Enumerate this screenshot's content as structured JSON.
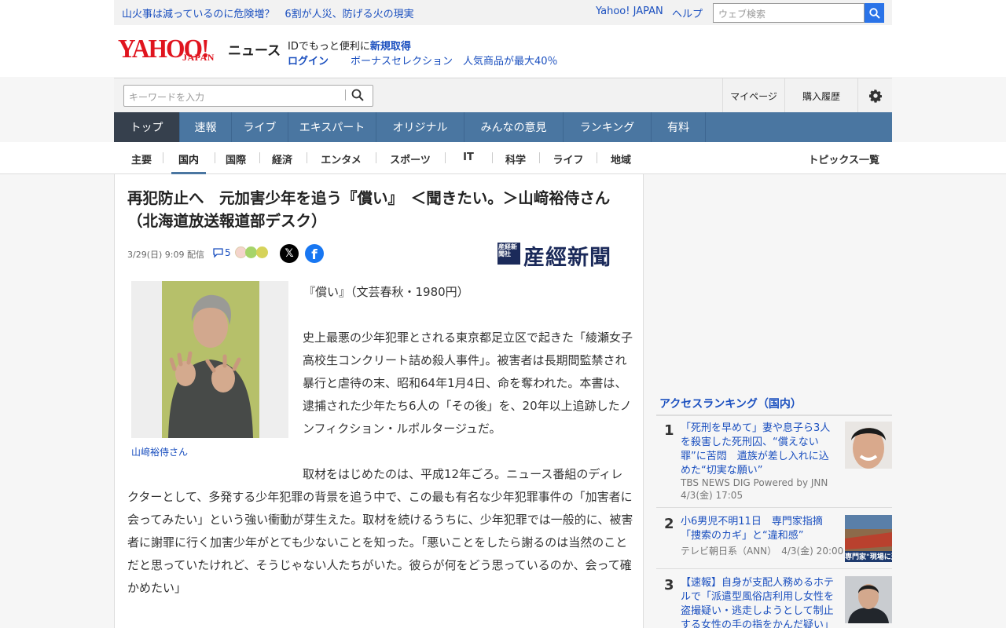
{
  "topbar": {
    "headline": "山火事は減っているのに危険増？　6割が人災、防げる火の現実",
    "yahoo_japan": "Yahoo! JAPAN",
    "help": "ヘルプ",
    "web_search_placeholder": "ウェブ検索"
  },
  "header": {
    "logo_text": "YAHOO!",
    "logo_sub": "JAPAN",
    "section": "ニュース",
    "id_text": "IDでもっと便利に",
    "id_link": "新規取得",
    "login": "ログイン",
    "promo": "ボーナスセレクション　人気商品が最大40％"
  },
  "search": {
    "placeholder": "キーワードを入力",
    "mypage": "マイページ",
    "history": "購入履歴"
  },
  "main_nav": [
    "トップ",
    "速報",
    "ライブ",
    "エキスパート",
    "オリジナル",
    "みんなの意見",
    "ランキング",
    "有料"
  ],
  "sub_nav": [
    "主要",
    "国内",
    "国際",
    "経済",
    "エンタメ",
    "スポーツ",
    "IT",
    "科学",
    "ライフ",
    "地域"
  ],
  "sub_nav_active": "国内",
  "topics_list": "トピックス一覧",
  "article": {
    "title": "再犯防止へ　元加害少年を追う『償い』　＜聞きたい。＞山﨑裕侍さん（北海道放送報道部デスク）",
    "date": "3/29(日) 9:09 配信",
    "comments": "5",
    "publisher": "産經新聞",
    "publisher_mark": "産経新聞社",
    "photo_caption": "山﨑裕侍さん",
    "p1": "『償い』（文芸春秋・1980円）",
    "p2": "史上最悪の少年犯罪とされる東京都足立区で起きた「綾瀬女子高校生コンクリート詰め殺人事件」。被害者は長期間監禁され暴行と虐待の末、昭和64年1月4日、命を奪われた。本書は、逮捕された少年たち6人の「その後」を、20年以上追跡したノンフィクション・ルポルタージュだ。",
    "p3": "取材をはじめたのは、平成12年ごろ。ニュース番組のディレクターとして、多発する少年犯罪の背景を追う中で、この最も有名な少年犯罪事件の「加害者に会ってみたい」という強い衝動が芽生えた。取材を続けるうちに、少年犯罪では一般的に、被害者に謝罪に行く加害少年がとても少ないことを知った。「悪いことをしたら謝るのは当然のことだと思っていたけれど、そうじゃない人たちがいた。彼らが何をどう思っているのか、会って確かめたい」"
  },
  "ranking": {
    "heading": "アクセスランキング（国内）",
    "items": [
      {
        "rank": "1",
        "title": "「死刑を早めて」妻や息子ら3人を殺害した死刑囚、“償えない罪”に苦悶　遺族が差し入れに込めた“切実な願い”",
        "source": "TBS NEWS DIG Powered by JNN",
        "time": "4/3(金) 17:05"
      },
      {
        "rank": "2",
        "title": "小6男児不明11日　専門家指摘「捜索のカギ」と“違和感”",
        "source": "テレビ朝日系（ANN）",
        "time": "4/3(金) 20:00",
        "thumb_text": "専門家\"現場に違"
      },
      {
        "rank": "3",
        "title": "【速報】自身が支配人務めるホテルで「派遣型風俗店利用し女性を盗撮疑い・逃走しようとして制止する女性の手の指をかんだ疑い」",
        "source": "",
        "time": ""
      }
    ]
  },
  "colors": {
    "link": "#1a4fbf",
    "nav_bg": "#4a76a1",
    "nav_active": "#36404d",
    "logo_red": "#e0141e",
    "search_btn": "#2a73e8"
  }
}
